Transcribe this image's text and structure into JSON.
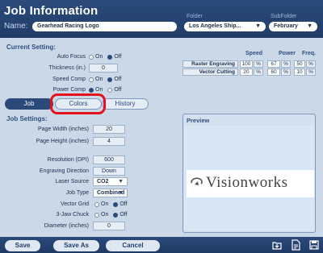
{
  "header": {
    "title": "Job Information",
    "name_label": "Name:",
    "name_value": "Gearhead Racing Logo",
    "folder_label": "Folder",
    "folder_value": "Los Angeles Ship...",
    "subfolder_label": "SubFolder",
    "subfolder_value": "February"
  },
  "current_setting": {
    "title": "Current Setting:",
    "auto_focus": {
      "label": "Auto Focus",
      "on": "On",
      "off": "Off",
      "selected": "Off"
    },
    "thickness": {
      "label": "Thickness (in.)",
      "value": "0"
    },
    "speed_comp": {
      "label": "Speed Comp",
      "on": "On",
      "off": "Off",
      "selected": "Off"
    },
    "power_comp": {
      "label": "Power Comp",
      "on": "On",
      "off": "Off",
      "selected": "On"
    }
  },
  "process_table": {
    "headers": [
      "Speed",
      "Power",
      "Freq."
    ],
    "unit": "%",
    "rows": [
      {
        "label": "Raster Engraving",
        "speed": "100",
        "power": "67",
        "freq": "50"
      },
      {
        "label": "Vector Cutting",
        "speed": "20",
        "power": "60",
        "freq": "10"
      }
    ]
  },
  "tabs": [
    {
      "label": "Job",
      "active": true
    },
    {
      "label": "Colors",
      "active": false
    },
    {
      "label": "History",
      "active": false
    }
  ],
  "job_settings": {
    "title": "Job Settings:",
    "page_width": {
      "label": "Page Width (inches)",
      "value": "20"
    },
    "page_height": {
      "label": "Page Height (inches)",
      "value": "4"
    },
    "resolution": {
      "label": "Resolution (DPI)",
      "value": "600"
    },
    "engraving_direction": {
      "label": "Engraving Direction",
      "value": "Down"
    },
    "laser_source": {
      "label": "Laser Source",
      "value": "CO2"
    },
    "job_type": {
      "label": "Job Type",
      "value": "Combined"
    },
    "vector_grid": {
      "label": "Vector Grid",
      "on": "On",
      "off": "Off",
      "selected": "Off"
    },
    "three_jaw_chuck": {
      "label": "3-Jaw Chuck",
      "on": "On",
      "off": "Off",
      "selected": "Off"
    },
    "diameter": {
      "label": "Diameter (inches)",
      "value": "0"
    }
  },
  "preview": {
    "title": "Preview",
    "logo_text": "Visionworks"
  },
  "footer": {
    "save": "Save",
    "save_as": "Save As",
    "cancel": "Cancel"
  },
  "colors": {
    "header_bg": "#213d69",
    "panel_bg": "#cbd8e8",
    "highlight": "#e3121c"
  },
  "icons": [
    "chevron-down-icon",
    "import-icon",
    "document-icon",
    "save-icon"
  ]
}
